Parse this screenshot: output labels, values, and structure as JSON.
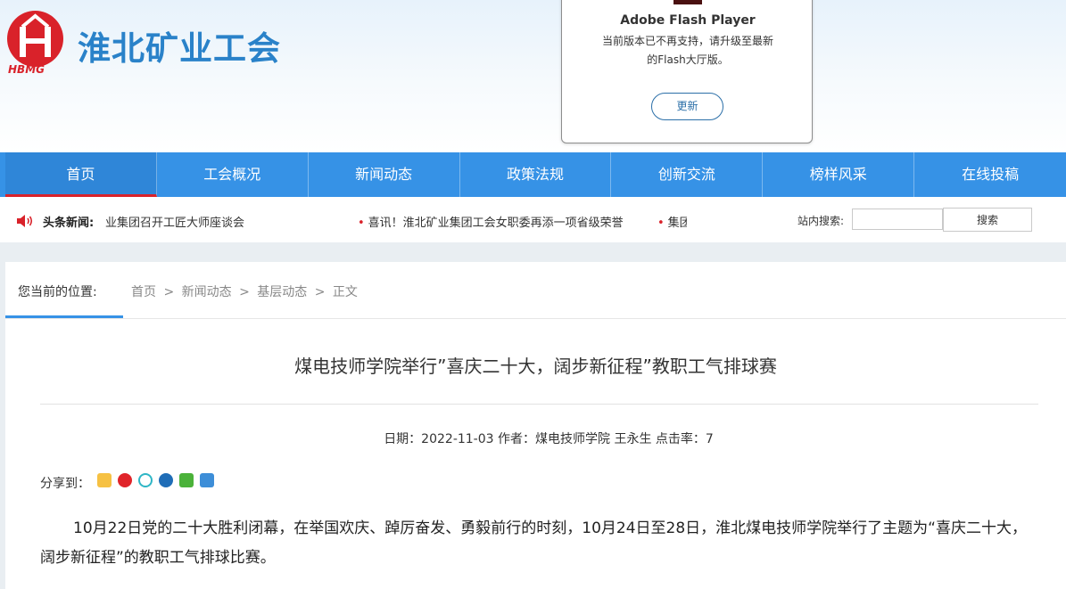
{
  "header": {
    "logo_text": "HBMG",
    "site_title": "淮北矿业工会"
  },
  "flash_popup": {
    "title": "Adobe Flash Player",
    "message_line1": "当前版本已不再支持，请升级至最新",
    "message_line2": "的Flash大厅版。",
    "button_label": "更新"
  },
  "nav": {
    "items": [
      {
        "label": "首页"
      },
      {
        "label": "工会概况"
      },
      {
        "label": "新闻动态"
      },
      {
        "label": "政策法规"
      },
      {
        "label": "创新交流"
      },
      {
        "label": "榜样风采"
      },
      {
        "label": "在线投稿"
      }
    ]
  },
  "ticker": {
    "label": "头条新闻:",
    "items": [
      "业集团召开工匠大师座谈会",
      "喜讯！淮北矿业集团工会女职委再添一项省级荣誉",
      "集团"
    ]
  },
  "search": {
    "label": "站内搜索:",
    "value": "",
    "button_label": "搜索"
  },
  "breadcrumb": {
    "label": "您当前的位置:",
    "path": [
      "首页",
      ">",
      "新闻动态",
      ">",
      "基层动态",
      ">",
      "正文"
    ]
  },
  "article": {
    "title": "煤电技师学院举行”喜庆二十大，阔步新征程”教职工气排球赛",
    "meta": "日期：2022-11-03 作者：煤电技师学院 王永生 点击率：7",
    "share_label": "分享到：",
    "body": "10月22日党的二十大胜利闭幕，在举国欢庆、踔厉奋发、勇毅前行的时刻，10月24日至28日，淮北煤电技师学院举行了主题为“喜庆二十大，阔步新征程”的教职工气排球比赛。"
  },
  "colors": {
    "brand_red": "#d9222a",
    "nav_blue": "#3692e6",
    "title_blue": "#2a82c9"
  }
}
